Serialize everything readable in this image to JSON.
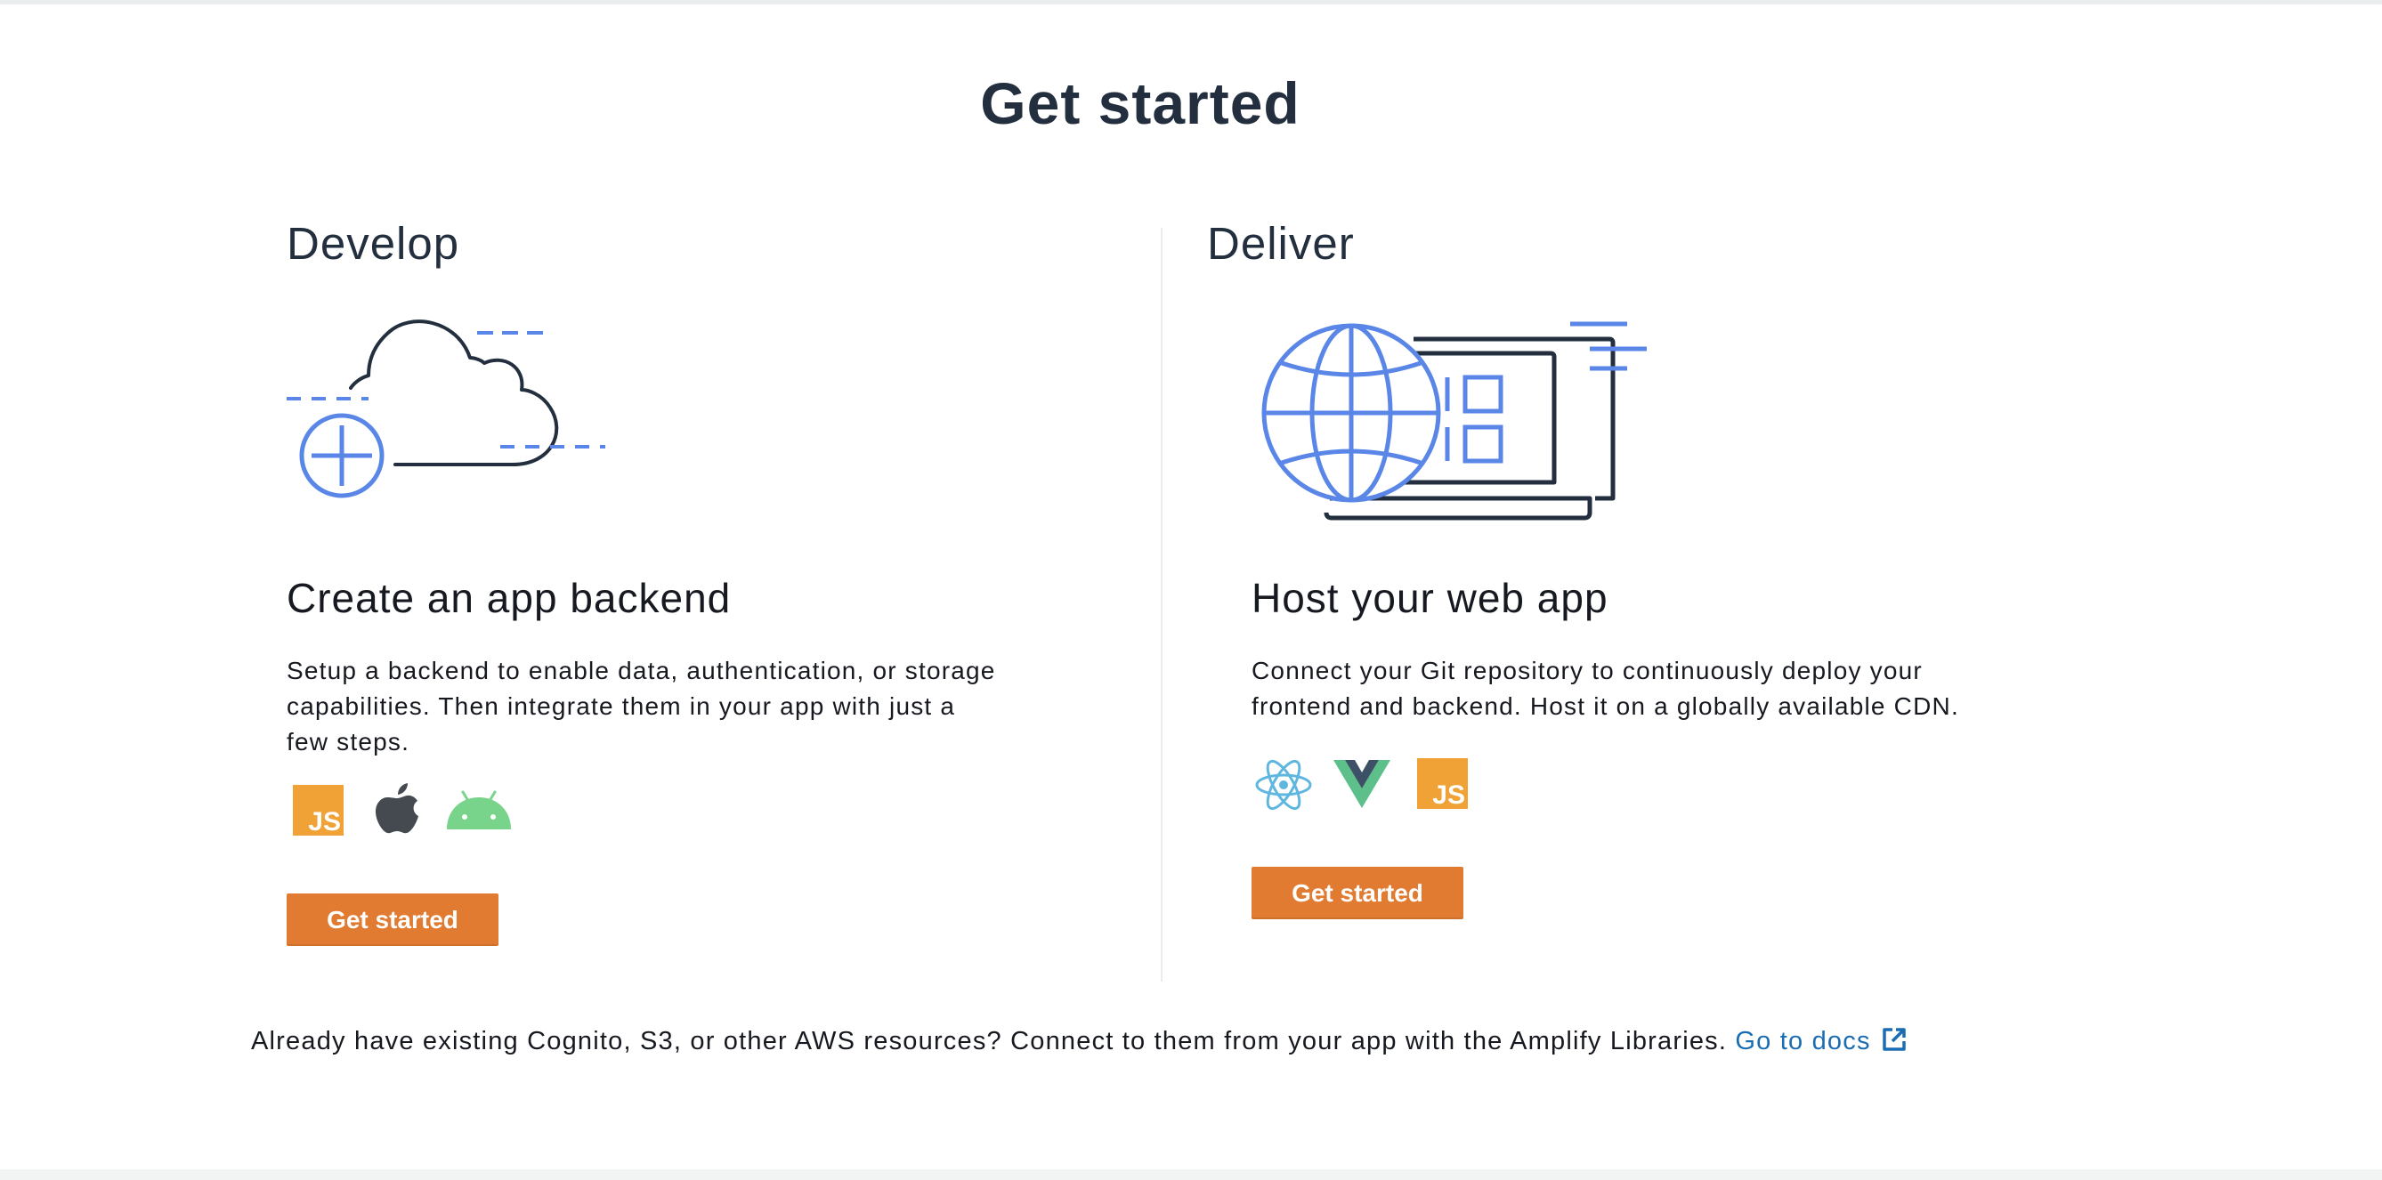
{
  "page": {
    "title": "Get started"
  },
  "develop": {
    "heading": "Develop",
    "card_title": "Create an app backend",
    "description_lines": [
      "Setup a backend to enable data, authentication, or storage",
      "capabilities. Then integrate them in your app with just a",
      "few steps."
    ],
    "platforms": [
      "javascript-icon",
      "apple-icon",
      "android-icon"
    ],
    "js_label": "JS",
    "button_label": "Get started"
  },
  "deliver": {
    "heading": "Deliver",
    "card_title": "Host your web app",
    "description_lines": [
      "Connect your Git repository to continuously deploy your",
      "frontend and backend. Host it on a globally available CDN."
    ],
    "frameworks": [
      "react-icon",
      "vue-icon",
      "javascript-icon"
    ],
    "js_label": "JS",
    "button_label": "Get started"
  },
  "footer": {
    "note": "Already have existing Cognito, S3, or other AWS resources? Connect to them from your app with the Amplify Libraries.",
    "link_label": "Go to docs",
    "link_icon": "external-link-icon"
  },
  "colors": {
    "accent_button": "#e07b31",
    "illustration_blue": "#5a86e8",
    "illustration_dark": "#232f3e",
    "link": "#1a6db3",
    "js_badge": "#f0a236",
    "android": "#78d48a",
    "react": "#5fb7e0",
    "vue_outer": "#5dbf8a",
    "vue_inner": "#3d5166"
  }
}
